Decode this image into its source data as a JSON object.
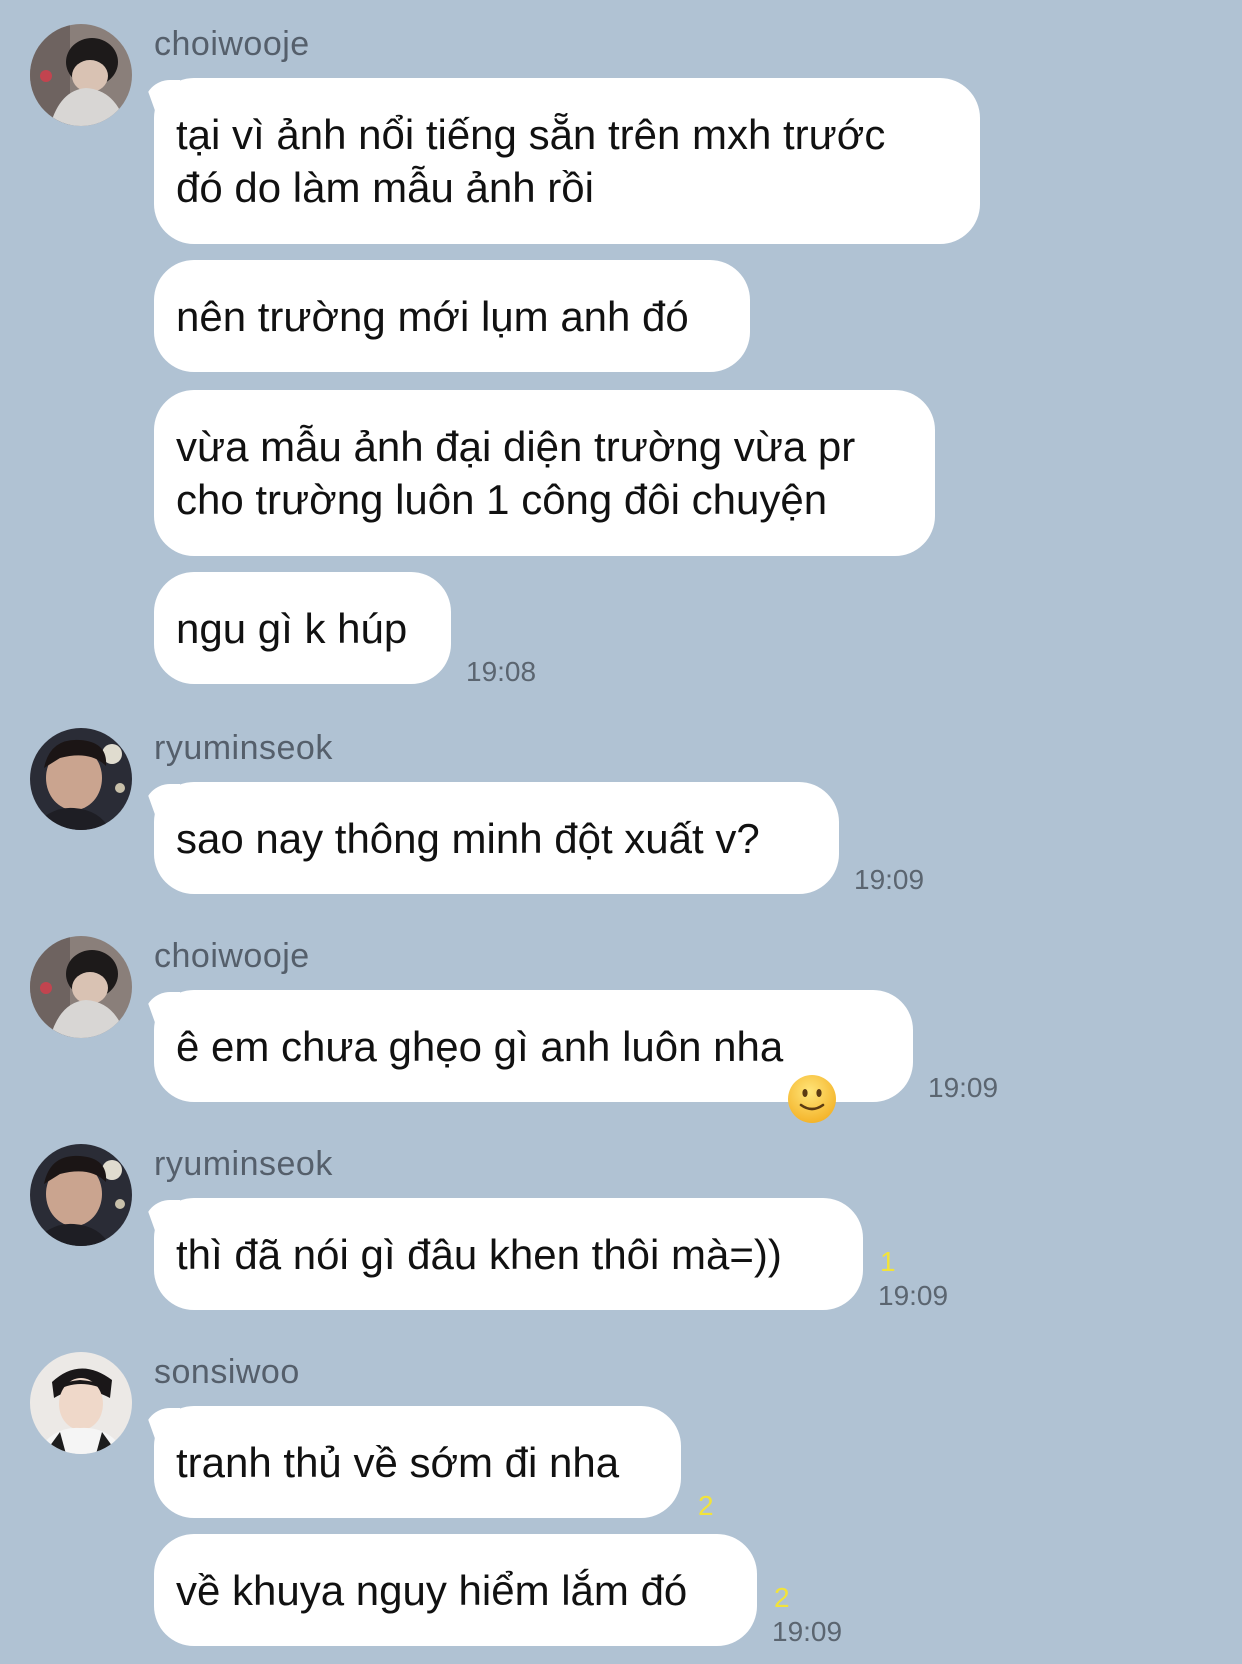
{
  "messages": [
    {
      "sender": "choiwooje",
      "avatar": "choiwooje-avatar",
      "bubbles": [
        "tại vì ảnh nổi tiếng sẵn trên mxh trước\nđó do làm mẫu ảnh rồi",
        "nên trường mới lụm anh đó",
        "vừa mẫu ảnh đại diện trường vừa pr\ncho trường luôn 1 công đôi chuyện",
        "ngu gì k húp"
      ],
      "time": "19:08"
    },
    {
      "sender": "ryuminseok",
      "avatar": "ryuminseok-avatar",
      "bubbles": [
        "sao nay thông minh đột xuất v?"
      ],
      "time": "19:09"
    },
    {
      "sender": "choiwooje",
      "avatar": "choiwooje-avatar",
      "bubbles": [
        "ê em chưa ghẹo gì anh luôn nha"
      ],
      "emoji": "slightly-smiling-face-icon",
      "time": "19:09"
    },
    {
      "sender": "ryuminseok",
      "avatar": "ryuminseok-avatar",
      "bubbles": [
        "thì đã nói gì đâu khen thôi mà=))"
      ],
      "unread": "1",
      "time": "19:09"
    },
    {
      "sender": "sonsiwoo",
      "avatar": "sonsiwoo-avatar",
      "bubbles": [
        "tranh thủ về sớm đi nha",
        "về khuya nguy hiểm lắm đó"
      ],
      "unread": [
        "2",
        "2"
      ],
      "time": "19:09"
    }
  ],
  "colors": {
    "background": "#b0c2d3",
    "bubble": "#ffffff",
    "unread": "#f2e33a",
    "meta_text": "#5b6570"
  }
}
